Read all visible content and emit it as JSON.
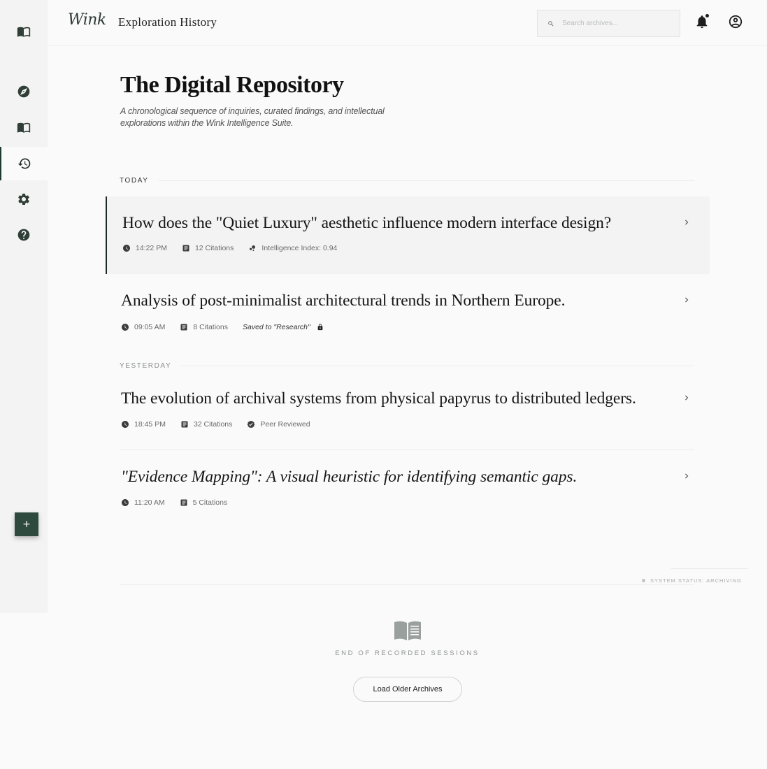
{
  "brand": {
    "logo": "Wink"
  },
  "header": {
    "title": "Exploration History",
    "search_placeholder": "Search archives..."
  },
  "sidebar": {
    "items": [
      {
        "icon": "library-icon"
      },
      {
        "icon": "compass-icon"
      },
      {
        "icon": "book-icon"
      },
      {
        "icon": "history-icon",
        "active": true
      },
      {
        "icon": "gear-icon"
      },
      {
        "icon": "help-icon"
      }
    ],
    "fab_label": "+"
  },
  "page": {
    "title": "The Digital Repository",
    "description": "A chronological sequence of inquiries, curated findings, and intellectual explorations within the Wink Intelligence Suite."
  },
  "sections": [
    {
      "label": "TODAY",
      "entries": [
        {
          "title": "How does the \"Quiet Luxury\" aesthetic influence modern interface design?",
          "time": "14:22 PM",
          "citations": "12 Citations",
          "extra": "Intelligence Index: 0.94"
        },
        {
          "title": "Analysis of post-minimalist architectural trends in Northern Europe.",
          "time": "09:05 AM",
          "citations": "8 Citations",
          "extra": "Saved to \"Research\""
        }
      ]
    },
    {
      "label": "YESTERDAY",
      "entries": [
        {
          "title": "The evolution of archival systems from physical papyrus to distributed ledgers.",
          "time": "18:45 PM",
          "citations": "32 Citations",
          "extra": "Peer Reviewed"
        },
        {
          "title": "\"Evidence Mapping\": A visual heuristic for identifying semantic gaps.",
          "time": "11:20 AM",
          "citations": "5 Citations"
        }
      ]
    }
  ],
  "status": {
    "text": "SYSTEM STATUS: ARCHIVING"
  },
  "footer": {
    "end_text": "END OF RECORDED SESSIONS",
    "load_label": "Load Older Archives"
  },
  "colors": {
    "accent": "#2e4a3e",
    "background": "#fbfafb",
    "sidebar": "#f2f3f2"
  }
}
